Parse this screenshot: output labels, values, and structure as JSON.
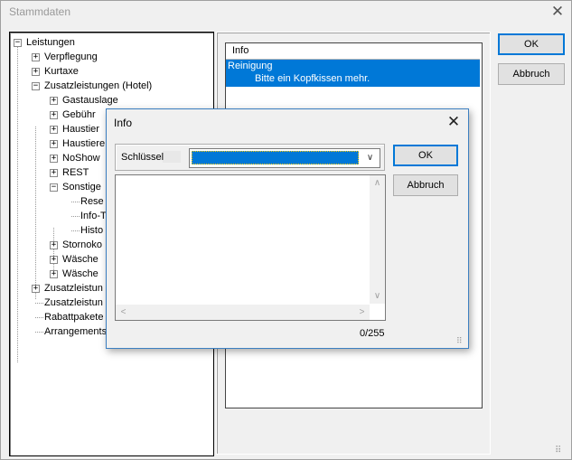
{
  "window": {
    "title": "Stammdaten",
    "close_label": "✕"
  },
  "tree": {
    "items": [
      {
        "label": "Leistungen",
        "level": 0,
        "expander": "−"
      },
      {
        "label": "Verpflegung",
        "level": 1,
        "expander": "+"
      },
      {
        "label": "Kurtaxe",
        "level": 1,
        "expander": "+"
      },
      {
        "label": "Zusatzleistungen (Hotel)",
        "level": 1,
        "expander": "−"
      },
      {
        "label": "Gastauslage",
        "level": 2,
        "expander": "+"
      },
      {
        "label": "Gebühr",
        "level": 2,
        "expander": "+"
      },
      {
        "label": "Haustier",
        "level": 2,
        "expander": "+"
      },
      {
        "label": "Haustiere",
        "level": 2,
        "expander": "+"
      },
      {
        "label": "NoShow",
        "level": 2,
        "expander": "+"
      },
      {
        "label": "REST",
        "level": 2,
        "expander": "+"
      },
      {
        "label": "Sonstige",
        "level": 2,
        "expander": "−"
      },
      {
        "label": "Rese",
        "level": 3,
        "expander": ""
      },
      {
        "label": "Info-T",
        "level": 3,
        "expander": ""
      },
      {
        "label": "Histo",
        "level": 3,
        "expander": ""
      },
      {
        "label": "Stornoko",
        "level": 2,
        "expander": "+"
      },
      {
        "label": "Wäsche",
        "level": 2,
        "expander": "+"
      },
      {
        "label": "Wäsche",
        "level": 2,
        "expander": "+"
      },
      {
        "label": "Zusatzleistun",
        "level": 1,
        "expander": "+"
      },
      {
        "label": "Zusatzleistun",
        "level": 1,
        "expander": ""
      },
      {
        "label": "Rabattpakete",
        "level": 1,
        "expander": ""
      },
      {
        "label": "Arrangements",
        "level": 1,
        "expander": ""
      }
    ]
  },
  "list": {
    "header": "Info",
    "selected": {
      "title": "Reinigung",
      "text": "Bitte ein Kopfkissen mehr."
    }
  },
  "buttons": {
    "ok": "OK",
    "cancel": "Abbruch"
  },
  "dialog": {
    "title": "Info",
    "close_label": "✕",
    "key_label": "Schlüssel",
    "ok": "OK",
    "cancel": "Abbruch",
    "counter": "0/255",
    "arrows": {
      "up": "∧",
      "down": "∨",
      "left": "<",
      "right": ">",
      "combo": "∨"
    }
  },
  "colors": {
    "selection": "#0078d7",
    "window_bg": "#f0f0f0"
  }
}
